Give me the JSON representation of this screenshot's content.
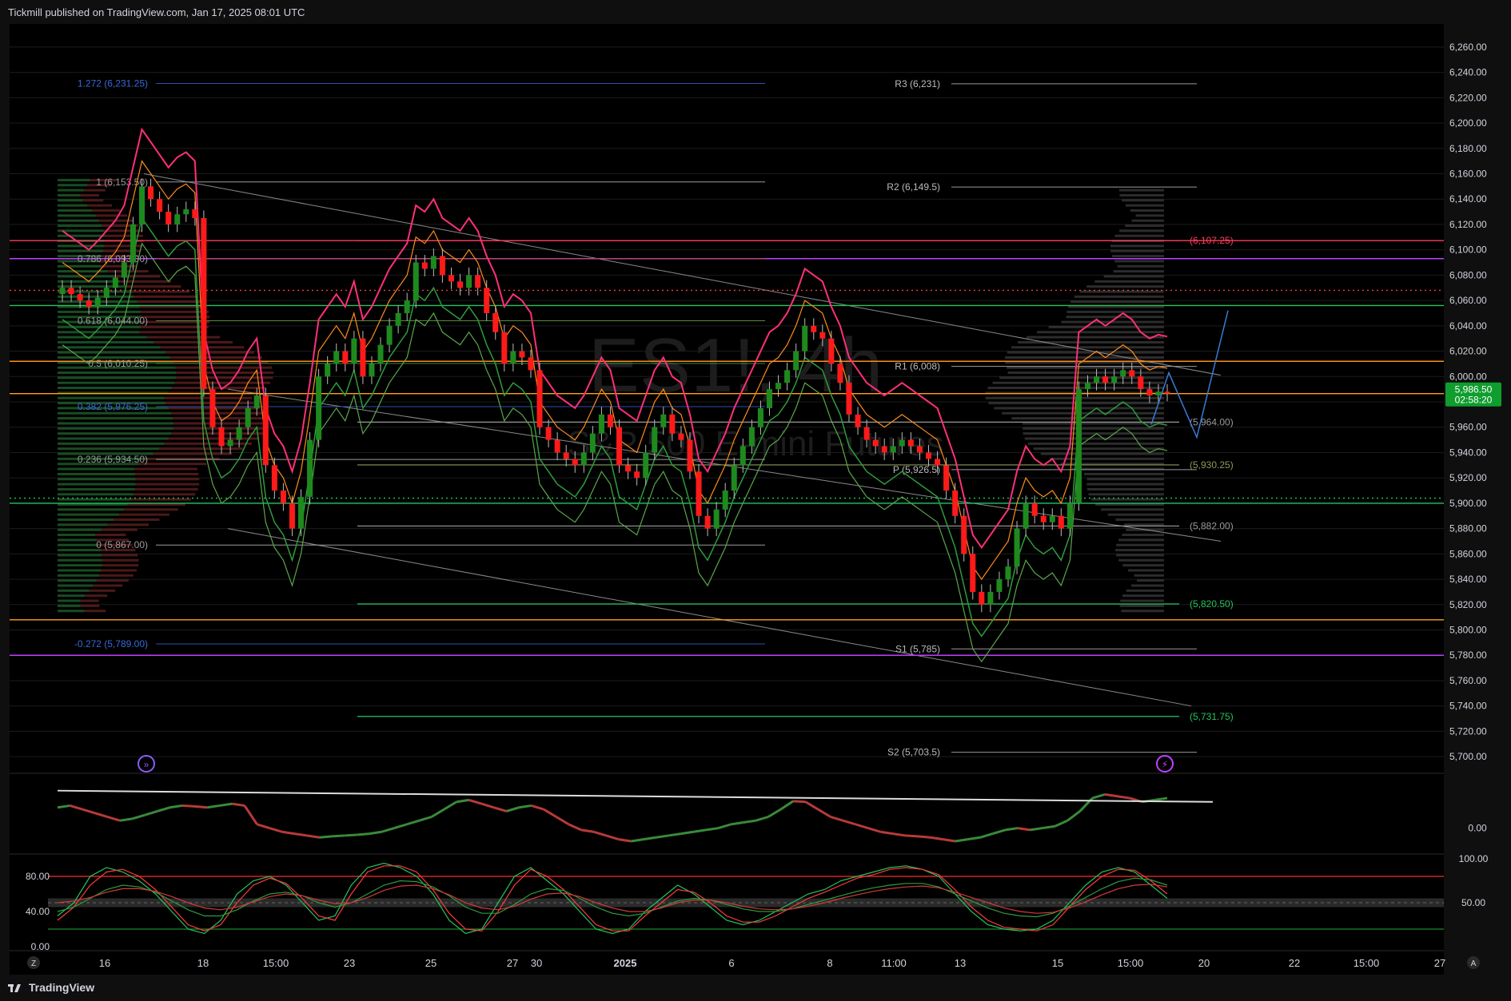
{
  "header": {
    "published_by": "Tickmill published on TradingView.com, Jan 17, 2025 08:01 UTC"
  },
  "footer": {
    "brand": "TradingView"
  },
  "watermark": {
    "line1": "ES1!, 4h",
    "line2": "S&P 500 E-mini Futures"
  },
  "colors": {
    "bg": "#000000",
    "up": "#1e8a1e",
    "down": "#ff1a1a",
    "grid": "#1c1c1c",
    "axis_text": "#d1d4dc",
    "price_badge": "#0f9d2e",
    "current_line": "#ffa31a",
    "fib_blue": "#2a4fb0",
    "pink": "#ff2f7a",
    "orange": "#ff8c1a",
    "green": "#22c55e",
    "magenta": "#c040ff"
  },
  "chart_data": [
    {
      "type": "candlestick",
      "title": "ES1!, 4h",
      "subtitle": "S&P 500 E-mini Futures",
      "ylim": [
        5690,
        6270
      ],
      "y_ticks": [
        5700,
        5720,
        5740,
        5760,
        5780,
        5800,
        5820,
        5840,
        5860,
        5880,
        5900,
        5920,
        5940,
        5960,
        5980,
        6000,
        6020,
        6040,
        6060,
        6080,
        6100,
        6120,
        6140,
        6160,
        6180,
        6200,
        6220,
        6240,
        6260
      ],
      "y_tick_labels": [
        "5,700.00",
        "5,720.00",
        "5,740.00",
        "5,760.00",
        "5,780.00",
        "5,800.00",
        "5,820.00",
        "5,840.00",
        "5,860.00",
        "5,880.00",
        "5,900.00",
        "5,920.00",
        "5,940.00",
        "5,960.00",
        "5,980.00",
        "6,000.00",
        "6,020.00",
        "6,040.00",
        "6,060.00",
        "6,080.00",
        "6,100.00",
        "6,120.00",
        "6,140.00",
        "6,160.00",
        "6,180.00",
        "6,200.00",
        "6,220.00",
        "6,240.00",
        "6,260.00"
      ],
      "x_tick_labels": [
        "16",
        "18",
        "15:00",
        "23",
        "25",
        "27",
        "30",
        "2025",
        "6",
        "8",
        "11:00",
        "13",
        "15",
        "15:00",
        "20",
        "22",
        "15:00",
        "27"
      ],
      "x_axis_buttons": [
        "Z",
        "A"
      ],
      "current_price": {
        "value": 5986.5,
        "label": "5,986.50",
        "countdown": "02:58:20"
      },
      "close": [
        6070,
        6065,
        6060,
        6055,
        6062,
        6070,
        6078,
        6090,
        6120,
        6150,
        6140,
        6130,
        6120,
        6128,
        6132,
        6125,
        5990,
        5960,
        5945,
        5950,
        5960,
        5975,
        5985,
        5930,
        5910,
        5900,
        5880,
        5905,
        5950,
        6000,
        6010,
        6020,
        6010,
        6030,
        6000,
        6010,
        6025,
        6040,
        6050,
        6060,
        6090,
        6085,
        6095,
        6080,
        6075,
        6070,
        6080,
        6070,
        6050,
        6035,
        6010,
        6020,
        6015,
        6005,
        5960,
        5950,
        5940,
        5935,
        5930,
        5940,
        5955,
        5970,
        5960,
        5930,
        5925,
        5920,
        5940,
        5960,
        5970,
        5955,
        5950,
        5925,
        5890,
        5880,
        5895,
        5910,
        5930,
        5945,
        5960,
        5975,
        5990,
        5995,
        6005,
        6020,
        6040,
        6035,
        6030,
        6010,
        5995,
        5970,
        5960,
        5950,
        5945,
        5940,
        5945,
        5950,
        5945,
        5940,
        5935,
        5930,
        5910,
        5890,
        5860,
        5830,
        5820,
        5830,
        5840,
        5850,
        5880,
        5900,
        5890,
        5885,
        5890,
        5880,
        5900,
        5990,
        5995,
        6000,
        5995,
        6000,
        6005,
        6000,
        5990,
        5985,
        5988,
        5986.5
      ],
      "fib_levels": [
        {
          "label": "1.272 (6,231.25)",
          "value": 6231.25,
          "color": "#2a4fb0"
        },
        {
          "label": "1 (6,153.50)",
          "value": 6153.5,
          "color": "#9a9a9a"
        },
        {
          "label": "0.786 (6,093.00)",
          "value": 6093.0,
          "color": "#b84a3a"
        },
        {
          "label": "0.618 (6,044.00)",
          "value": 6044.0,
          "color": "#5a8a3a"
        },
        {
          "label": "0.5 (6,010.25)",
          "value": 6010.25,
          "color": "#2e8a2e"
        },
        {
          "label": "0.382 (5,976.25)",
          "value": 5976.25,
          "color": "#2a4fb0"
        },
        {
          "label": "0.236 (5,934.50)",
          "value": 5934.5,
          "color": "#9a9a9a"
        },
        {
          "label": "0 (5,867.00)",
          "value": 5867.0,
          "color": "#9a9a9a"
        },
        {
          "label": "-0.272 (5,789.00)",
          "value": 5789.0,
          "color": "#2a4fb0"
        }
      ],
      "pivots": [
        {
          "label": "R3 (6,231)",
          "value": 6231
        },
        {
          "label": "R2 (6,149.5)",
          "value": 6149.5
        },
        {
          "label": "R1 (6,008)",
          "value": 6008
        },
        {
          "label": "P (5,926.5)",
          "value": 5926.5
        },
        {
          "label": "S1 (5,785)",
          "value": 5785
        },
        {
          "label": "S2 (5,703.5)",
          "value": 5703.5
        }
      ],
      "right_levels": [
        {
          "label": "(6,107.25)",
          "value": 6107.25,
          "color": "#ff3b5c"
        },
        {
          "label": "(5,964.00)",
          "value": 5964.0,
          "color": "#9a9a9a"
        },
        {
          "label": "(5,930.25)",
          "value": 5930.25,
          "color": "#8a9a5a"
        },
        {
          "label": "(5,882.00)",
          "value": 5882.0,
          "color": "#9a9a9a"
        },
        {
          "label": "(5,820.50)",
          "value": 5820.5,
          "color": "#22c55e"
        },
        {
          "label": "(5,731.75)",
          "value": 5731.75,
          "color": "#22c55e"
        }
      ],
      "horizontal_lines": [
        {
          "value": 6107.25,
          "color": "#ff3b5c"
        },
        {
          "value": 6093.0,
          "color": "#c040ff"
        },
        {
          "value": 6068.0,
          "color": "#ff3b3b",
          "dotted": true
        },
        {
          "value": 6056.0,
          "color": "#22c55e"
        },
        {
          "value": 6012.0,
          "color": "#ff8c1a"
        },
        {
          "value": 5986.5,
          "color": "#ffa31a"
        },
        {
          "value": 5904.0,
          "color": "#22c55e",
          "dotted": true
        },
        {
          "value": 5900.0,
          "color": "#22c55e"
        },
        {
          "value": 5808.0,
          "color": "#ffa31a"
        },
        {
          "value": 5780.0,
          "color": "#c040ff"
        }
      ]
    },
    {
      "type": "line",
      "title": "",
      "y_tick_labels": [
        "0.00"
      ],
      "values": [
        0.55,
        0.6,
        0.5,
        0.4,
        0.3,
        0.2,
        0.25,
        0.35,
        0.45,
        0.55,
        0.6,
        0.58,
        0.55,
        0.6,
        0.65,
        0.6,
        0.1,
        0.0,
        -0.1,
        -0.15,
        -0.2,
        -0.25,
        -0.22,
        -0.2,
        -0.18,
        -0.15,
        -0.1,
        0.0,
        0.1,
        0.2,
        0.3,
        0.5,
        0.7,
        0.75,
        0.65,
        0.55,
        0.45,
        0.55,
        0.6,
        0.5,
        0.3,
        0.1,
        -0.05,
        -0.1,
        -0.2,
        -0.3,
        -0.35,
        -0.3,
        -0.25,
        -0.2,
        -0.15,
        -0.1,
        -0.05,
        0.0,
        0.1,
        0.15,
        0.2,
        0.3,
        0.5,
        0.72,
        0.7,
        0.5,
        0.3,
        0.2,
        0.1,
        0.0,
        -0.1,
        -0.15,
        -0.2,
        -0.22,
        -0.25,
        -0.3,
        -0.35,
        -0.3,
        -0.25,
        -0.15,
        -0.05,
        0.0,
        -0.05,
        0.0,
        0.05,
        0.2,
        0.45,
        0.8,
        0.9,
        0.85,
        0.8,
        0.7,
        0.75,
        0.8
      ],
      "trendline": [
        1.0,
        0.7
      ]
    },
    {
      "type": "line",
      "title": "",
      "y_ticks": [
        0,
        40,
        80
      ],
      "y_tick_labels": [
        "0.00",
        "40.00",
        "80.00"
      ],
      "right_labels": [
        "100.00",
        "50.00"
      ],
      "overbought": 80,
      "oversold": 20,
      "band": [
        45,
        55
      ],
      "series": [
        {
          "color": "#22c55e",
          "values": [
            35,
            50,
            80,
            90,
            85,
            75,
            60,
            40,
            20,
            15,
            30,
            60,
            75,
            80,
            70,
            50,
            30,
            35,
            70,
            90,
            95,
            90,
            80,
            60,
            30,
            15,
            20,
            50,
            80,
            90,
            75,
            60,
            40,
            20,
            15,
            20,
            40,
            55,
            70,
            60,
            45,
            30,
            25,
            30,
            40,
            50,
            60,
            65,
            75,
            80,
            85,
            90,
            92,
            88,
            80,
            60,
            40,
            25,
            20,
            18,
            20,
            30,
            50,
            70,
            85,
            90,
            85,
            70,
            55
          ]
        },
        {
          "color": "#ff3b3b",
          "values": [
            30,
            45,
            70,
            85,
            88,
            80,
            65,
            45,
            25,
            18,
            25,
            50,
            70,
            78,
            72,
            55,
            35,
            30,
            60,
            85,
            92,
            92,
            85,
            65,
            38,
            20,
            18,
            40,
            70,
            88,
            80,
            65,
            45,
            25,
            18,
            18,
            35,
            50,
            65,
            62,
            50,
            35,
            28,
            28,
            35,
            45,
            55,
            62,
            70,
            78,
            82,
            88,
            90,
            88,
            82,
            65,
            45,
            30,
            22,
            20,
            18,
            25,
            45,
            65,
            80,
            88,
            87,
            75,
            60
          ]
        },
        {
          "color": "#2e9c3c",
          "values": [
            40,
            45,
            55,
            65,
            70,
            68,
            62,
            52,
            42,
            35,
            35,
            42,
            52,
            60,
            62,
            58,
            50,
            45,
            50,
            60,
            70,
            75,
            74,
            68,
            58,
            45,
            38,
            38,
            48,
            60,
            66,
            64,
            55,
            45,
            38,
            35,
            38,
            45,
            52,
            55,
            53,
            48,
            43,
            40,
            40,
            43,
            48,
            53,
            58,
            63,
            67,
            70,
            72,
            72,
            68,
            60,
            52,
            44,
            38,
            35,
            34,
            38,
            46,
            56,
            66,
            74,
            78,
            76,
            70
          ]
        },
        {
          "color": "#d23a3a",
          "values": [
            50,
            52,
            56,
            62,
            66,
            66,
            63,
            57,
            50,
            44,
            42,
            45,
            51,
            57,
            60,
            58,
            53,
            49,
            50,
            56,
            64,
            69,
            70,
            66,
            59,
            50,
            44,
            42,
            46,
            54,
            60,
            61,
            57,
            50,
            44,
            40,
            40,
            44,
            50,
            53,
            53,
            50,
            46,
            43,
            42,
            43,
            46,
            50,
            55,
            59,
            63,
            66,
            68,
            69,
            67,
            62,
            56,
            50,
            44,
            40,
            38,
            39,
            44,
            51,
            59,
            66,
            70,
            71,
            68
          ]
        }
      ]
    }
  ]
}
